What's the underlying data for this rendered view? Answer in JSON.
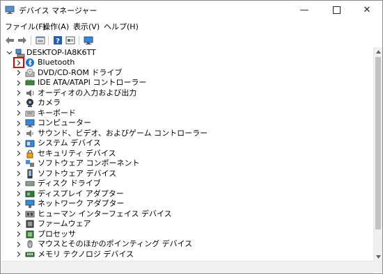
{
  "window": {
    "title": "デバイス マネージャー",
    "minimize_glyph": "—",
    "close_glyph": "✕"
  },
  "menu": {
    "items": [
      {
        "label": "ファイル(F)"
      },
      {
        "label": "操作(A)"
      },
      {
        "label": "表示(V)"
      },
      {
        "label": "ヘルプ(H)"
      }
    ]
  },
  "toolbar": {
    "buttons": [
      "back-icon",
      "forward-icon",
      "properties-icon",
      "help-icon",
      "show-hidden-icon",
      "monitor-icon"
    ]
  },
  "tree": {
    "root": {
      "label": "DESKTOP-IA8K6TT",
      "expanded": true,
      "icon": "computer-icon"
    },
    "items": [
      {
        "label": "Bluetooth",
        "icon": "bluetooth-icon",
        "highlighted": true
      },
      {
        "label": "DVD/CD-ROM ドライブ",
        "icon": "dvd-icon"
      },
      {
        "label": "IDE ATA/ATAPI コントローラー",
        "icon": "ide-controller-icon"
      },
      {
        "label": "オーディオの入力および出力",
        "icon": "audio-icon"
      },
      {
        "label": "カメラ",
        "icon": "camera-icon"
      },
      {
        "label": "キーボード",
        "icon": "keyboard-icon"
      },
      {
        "label": "コンピューター",
        "icon": "computer-icon"
      },
      {
        "label": "サウンド、ビデオ、およびゲーム コントローラー",
        "icon": "sound-icon"
      },
      {
        "label": "システム デバイス",
        "icon": "system-device-icon"
      },
      {
        "label": "セキュリティ デバイス",
        "icon": "security-icon"
      },
      {
        "label": "ソフトウェア コンポーネント",
        "icon": "software-component-icon"
      },
      {
        "label": "ソフトウェア デバイス",
        "icon": "software-device-icon"
      },
      {
        "label": "ディスク ドライブ",
        "icon": "disk-drive-icon"
      },
      {
        "label": "ディスプレイ アダプター",
        "icon": "display-adapter-icon"
      },
      {
        "label": "ネットワーク アダプター",
        "icon": "network-adapter-icon"
      },
      {
        "label": "ヒューマン インターフェイス デバイス",
        "icon": "hid-icon"
      },
      {
        "label": "ファームウェア",
        "icon": "firmware-icon"
      },
      {
        "label": "プロセッサ",
        "icon": "processor-icon"
      },
      {
        "label": "マウスとそのほかのポインティング デバイス",
        "icon": "mouse-icon"
      },
      {
        "label": "メモリ テクノロジ デバイス",
        "icon": "memory-icon"
      }
    ]
  }
}
